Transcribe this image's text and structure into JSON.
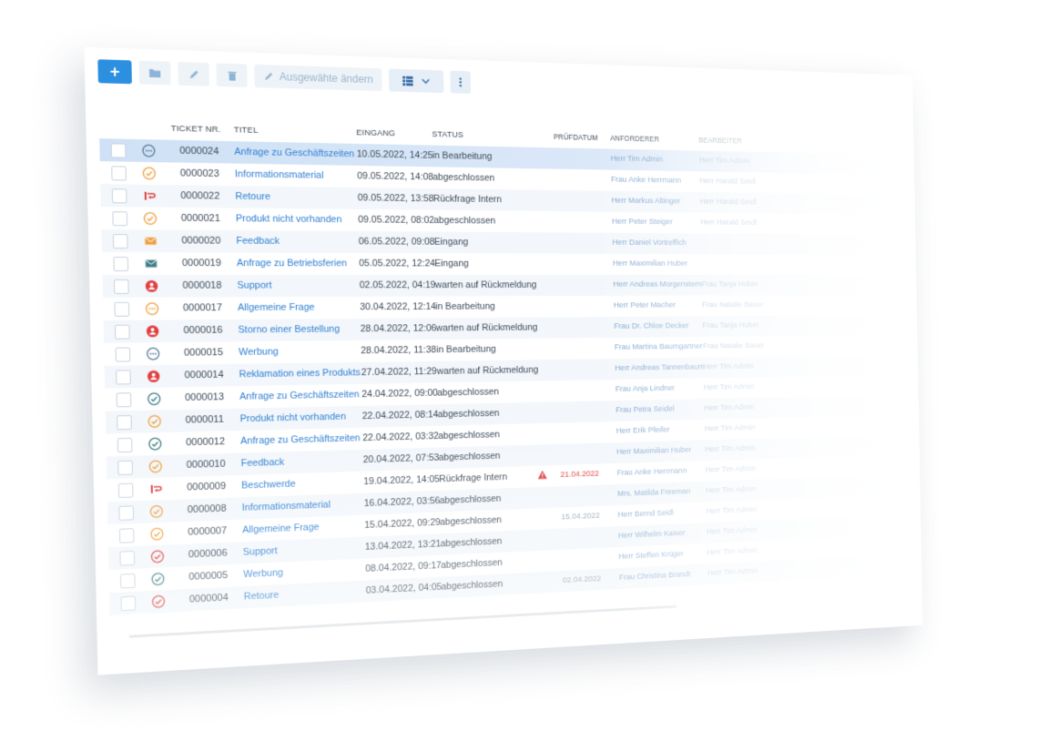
{
  "toolbar": {
    "add_label": "+",
    "bulk_edit_label": "Ausgewähte ändern"
  },
  "table": {
    "headers": {
      "ticket_nr": "TICKET NR.",
      "titel": "TITEL",
      "eingang": "EINGANG",
      "status": "STATUS",
      "pruefdatum": "PRÜFDATUM",
      "anforderer": "ANFORDERER",
      "bearbeiter": "BEARBEITER"
    },
    "rows": [
      {
        "nr": "0000024",
        "titel": "Anfrage zu Geschäftszeiten",
        "eingang": "10.05.2022, 14:25",
        "status": "in Bearbeitung",
        "pruef": "",
        "anf": "Herr Tim Admin",
        "bear": "Herr Tim Admin",
        "icon": "chat-blue"
      },
      {
        "nr": "0000023",
        "titel": "Informationsmaterial",
        "eingang": "09.05.2022, 14:08",
        "status": "abgeschlossen",
        "pruef": "",
        "anf": "Frau Anke Herrmann",
        "bear": "Herr Harald Seidl",
        "icon": "check-orange"
      },
      {
        "nr": "0000022",
        "titel": "Retoure",
        "eingang": "09.05.2022, 13:58",
        "status": "Rückfrage Intern",
        "pruef": "",
        "anf": "Herr Markus Altinger",
        "bear": "Herr Harald Seidl",
        "icon": "return-red"
      },
      {
        "nr": "0000021",
        "titel": "Produkt nicht vorhanden",
        "eingang": "09.05.2022, 08:02",
        "status": "abgeschlossen",
        "pruef": "",
        "anf": "Herr Peter Steiger",
        "bear": "Herr Harald Seidl",
        "icon": "check-orange"
      },
      {
        "nr": "0000020",
        "titel": "Feedback",
        "eingang": "06.05.2022, 09:08",
        "status": "Eingang",
        "pruef": "",
        "anf": "Herr Daniel Vortreffich",
        "bear": "",
        "icon": "mail-orange"
      },
      {
        "nr": "0000019",
        "titel": "Anfrage zu Betriebsferien",
        "eingang": "05.05.2022, 12:24",
        "status": "Eingang",
        "pruef": "",
        "anf": "Herr Maximilian Huber",
        "bear": "",
        "icon": "mail-teal"
      },
      {
        "nr": "0000018",
        "titel": "Support",
        "eingang": "02.05.2022, 04:19",
        "status": "warten auf Rückmeldung",
        "pruef": "",
        "anf": "Herr Andreas Morgenstern",
        "bear": "Frau Tanja Huber",
        "icon": "user-red"
      },
      {
        "nr": "0000017",
        "titel": "Allgemeine Frage",
        "eingang": "30.04.2022, 12:14",
        "status": "in Bearbeitung",
        "pruef": "",
        "anf": "Herr Peter Macher",
        "bear": "Frau Natalie Bauer",
        "icon": "chat-orange"
      },
      {
        "nr": "0000016",
        "titel": "Storno einer Bestellung",
        "eingang": "28.04.2022, 12:06",
        "status": "warten auf Rückmeldung",
        "pruef": "",
        "anf": "Frau Dr. Chloe Decker",
        "bear": "Frau Tanja Huber",
        "icon": "user-red"
      },
      {
        "nr": "0000015",
        "titel": "Werbung",
        "eingang": "28.04.2022, 11:38",
        "status": "in Bearbeitung",
        "pruef": "",
        "anf": "Frau Martina Baumgartner",
        "bear": "Frau Natalie Bauer",
        "icon": "chat-blue"
      },
      {
        "nr": "0000014",
        "titel": "Reklamation eines Produkts",
        "eingang": "27.04.2022, 11:29",
        "status": "warten auf Rückmeldung",
        "pruef": "",
        "anf": "Herr Andreas Tannenbaum",
        "bear": "Herr Tim Admin",
        "icon": "user-red"
      },
      {
        "nr": "0000013",
        "titel": "Anfrage zu Geschäftszeiten",
        "eingang": "24.04.2022, 09:00",
        "status": "abgeschlossen",
        "pruef": "",
        "anf": "Frau Anja Lindner",
        "bear": "Herr Tim Admin",
        "icon": "check-teal"
      },
      {
        "nr": "0000011",
        "titel": "Produkt nicht vorhanden",
        "eingang": "22.04.2022, 08:14",
        "status": "abgeschlossen",
        "pruef": "",
        "anf": "Frau Petra Seidel",
        "bear": "Herr Tim Admin",
        "icon": "check-orange"
      },
      {
        "nr": "0000012",
        "titel": "Anfrage zu Geschäftszeiten",
        "eingang": "22.04.2022, 03:32",
        "status": "abgeschlossen",
        "pruef": "",
        "anf": "Herr Erik Pfeifer",
        "bear": "Herr Tim Admin",
        "icon": "check-teal"
      },
      {
        "nr": "0000010",
        "titel": "Feedback",
        "eingang": "20.04.2022, 07:53",
        "status": "abgeschlossen",
        "pruef": "",
        "anf": "Herr Maximilian Huber",
        "bear": "Herr Tim Admin",
        "icon": "check-orange"
      },
      {
        "nr": "0000009",
        "titel": "Beschwerde",
        "eingang": "19.04.2022, 14:05",
        "status": "Rückfrage Intern",
        "pruef": "21.04.2022",
        "anf": "Frau Anke Herrmann",
        "bear": "Herr Tim Admin",
        "icon": "return-red",
        "warn": true
      },
      {
        "nr": "0000008",
        "titel": "Informationsmaterial",
        "eingang": "16.04.2022, 03:56",
        "status": "abgeschlossen",
        "pruef": "",
        "anf": "Mrs. Matilda Freeman",
        "bear": "Herr Tim Admin",
        "icon": "check-orange"
      },
      {
        "nr": "0000007",
        "titel": "Allgemeine Frage",
        "eingang": "15.04.2022, 09:29",
        "status": "abgeschlossen",
        "pruef": "15.04.2022",
        "anf": "Herr Bernd Seidl",
        "bear": "Herr Tim Admin",
        "icon": "check-orange"
      },
      {
        "nr": "0000006",
        "titel": "Support",
        "eingang": "13.04.2022, 13:21",
        "status": "abgeschlossen",
        "pruef": "",
        "anf": "Herr Wilhelm Kaiser",
        "bear": "Herr Tim Admin",
        "icon": "check-red"
      },
      {
        "nr": "0000005",
        "titel": "Werbung",
        "eingang": "08.04.2022, 09:17",
        "status": "abgeschlossen",
        "pruef": "",
        "anf": "Herr Steffen Krüger",
        "bear": "Herr Tim Admin",
        "icon": "check-teal"
      },
      {
        "nr": "0000004",
        "titel": "Retoure",
        "eingang": "03.04.2022, 04:05",
        "status": "abgeschlossen",
        "pruef": "02.04.2022",
        "anf": "Frau Christina Brandt",
        "bear": "Herr Tim Admin",
        "icon": "check-red"
      }
    ]
  }
}
